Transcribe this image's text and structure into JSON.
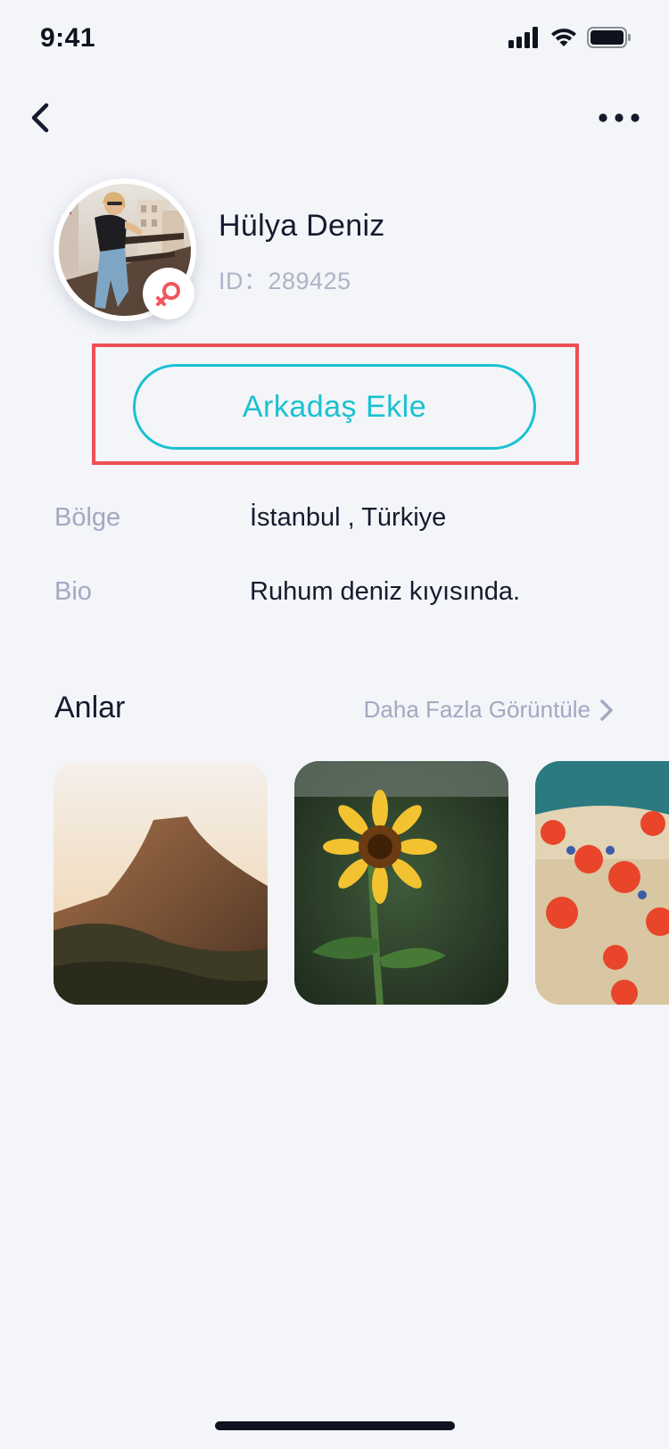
{
  "status_bar": {
    "time": "9:41"
  },
  "profile": {
    "name": "Hülya Deniz",
    "id_text": "ID：289425",
    "gender_icon": "female-icon",
    "accent": "#1ac1d1",
    "gender_color": "#f0585c"
  },
  "actions": {
    "add_friend_label": "Arkadaş Ekle"
  },
  "info": [
    {
      "label": "Bölge",
      "value": "İstanbul , Türkiye"
    },
    {
      "label": "Bio",
      "value": "Ruhum deniz kıyısında."
    }
  ],
  "moments": {
    "title": "Anlar",
    "view_more_label": "Daha Fazla Görüntüle",
    "items": [
      "mountain-photo",
      "sunflower-photo",
      "poppies-photo"
    ]
  },
  "icons": {
    "back": "chevron-left-icon",
    "more": "more-dots-icon",
    "view_more": "chevron-right-icon"
  },
  "highlight_color": "#ee4f55"
}
